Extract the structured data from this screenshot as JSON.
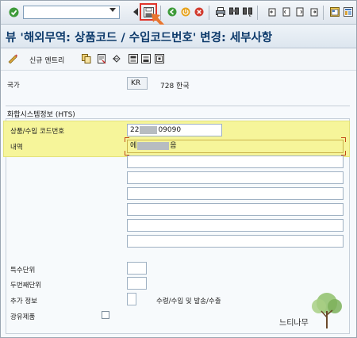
{
  "toolbar": {
    "icons": [
      "check-icon",
      "back-nav-icon",
      "save-icon",
      "back-icon",
      "exit-icon",
      "cancel-icon",
      "print-icon",
      "find-icon",
      "find-next-icon",
      "first-page-icon",
      "previous-page-icon",
      "next-page-icon",
      "last-page-icon",
      "new-session-icon",
      "shortcut-icon"
    ],
    "highlight_color": "#e0352b",
    "arrow_color": "#e8762f"
  },
  "title": "뷰 '해외무역: 상품코드 / 수입코드번호' 변경: 세부사항",
  "app_toolbar": {
    "new_entries": "신규 엔트리"
  },
  "country": {
    "label": "국가",
    "code": "KR",
    "name": "728 한국"
  },
  "hts": {
    "group_title": "화합시스템정보 (HTS)",
    "commodity_label": "상품/수입 코드번호",
    "commodity_value_prefix": "22",
    "commodity_value_suffix": "09090",
    "description_label": "내역",
    "description_prefix": "에",
    "description_suffix": "음",
    "highlight_color": "#f6f59a"
  },
  "units": {
    "special_unit_label": "특수단위",
    "second_unit_label": "두번째단위",
    "additional_info_label": "추가 정보",
    "additional_info_note": "수령/수입 및 발송/수출",
    "mineral_oil_label": "광유제품"
  },
  "watermark": {
    "text": "느티나무"
  }
}
